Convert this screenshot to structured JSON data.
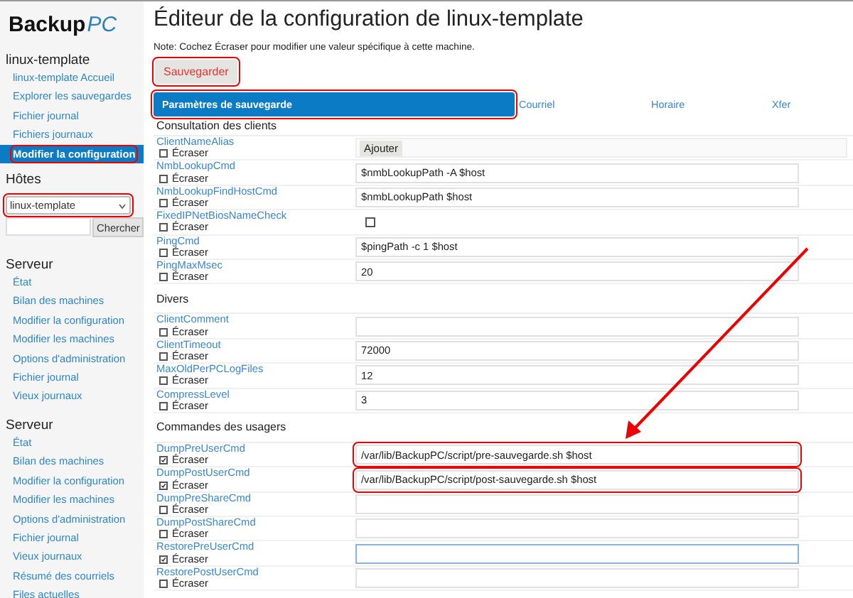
{
  "logo": {
    "text": "Backup",
    "accent": "PC"
  },
  "sidebar": {
    "host_section": {
      "title": "linux-template",
      "items": [
        {
          "label": "linux-template Accueil",
          "selected": false,
          "highlighted": false
        },
        {
          "label": "Explorer les sauvegardes",
          "selected": false,
          "highlighted": false
        },
        {
          "label": "Fichier journal",
          "selected": false,
          "highlighted": false
        },
        {
          "label": "Fichiers journaux",
          "selected": false,
          "highlighted": false
        },
        {
          "label": "Modifier la configuration",
          "selected": true,
          "highlighted": true
        }
      ]
    },
    "hosts": {
      "title": "Hôtes",
      "select_value": "linux-template",
      "highlighted": true,
      "search_button": "Chercher"
    },
    "server_sections": [
      {
        "title": "Serveur",
        "items": [
          {
            "label": "État"
          },
          {
            "label": "Bilan des machines"
          },
          {
            "label": "Modifier la configuration"
          },
          {
            "label": "Modifier les machines"
          },
          {
            "label": "Options d'administration"
          },
          {
            "label": "Fichier journal"
          },
          {
            "label": "Vieux journaux"
          }
        ]
      },
      {
        "title": "Serveur",
        "items": [
          {
            "label": "État"
          },
          {
            "label": "Bilan des machines"
          },
          {
            "label": "Modifier la configuration"
          },
          {
            "label": "Modifier les machines"
          },
          {
            "label": "Options d'administration"
          },
          {
            "label": "Fichier journal"
          },
          {
            "label": "Vieux journaux"
          },
          {
            "label": "Résumé des courriels"
          },
          {
            "label": "Files actuelles"
          }
        ]
      }
    ]
  },
  "main": {
    "title": "Éditeur de la configuration de linux-template",
    "note": "Note: Cochez Écraser pour modifier une valeur spécifique à cette machine.",
    "save_button": {
      "label": "Sauvegarder",
      "highlighted": true
    },
    "tabs": [
      {
        "label": "Paramètres de sauvegarde",
        "selected": true,
        "highlighted": true
      },
      {
        "label": "Courriel",
        "selected": false,
        "highlighted": false
      },
      {
        "label": "Horaire",
        "selected": false,
        "highlighted": false
      },
      {
        "label": "Xfer",
        "selected": false,
        "highlighted": false
      }
    ],
    "sections": [
      {
        "title": "Consultation des clients",
        "rows": [
          {
            "name": "ClientNameAlias",
            "override_label": "Écraser",
            "override": false,
            "kind": "add",
            "button": "Ajouter"
          },
          {
            "name": "NmbLookupCmd",
            "override_label": "Écraser",
            "override": false,
            "kind": "text",
            "value": "$nmbLookupPath -A $host",
            "highlighted": false,
            "focused": false
          },
          {
            "name": "NmbLookupFindHostCmd",
            "override_label": "Écraser",
            "override": false,
            "kind": "text",
            "value": "$nmbLookupPath $host",
            "highlighted": false,
            "focused": false
          },
          {
            "name": "FixedIPNetBiosNameCheck",
            "override_label": "Écraser",
            "override": false,
            "kind": "checkbox",
            "checked": false
          },
          {
            "name": "PingCmd",
            "override_label": "Écraser",
            "override": false,
            "kind": "text",
            "value": "$pingPath -c 1 $host",
            "highlighted": false,
            "focused": false
          },
          {
            "name": "PingMaxMsec",
            "override_label": "Écraser",
            "override": false,
            "kind": "text",
            "value": "20",
            "highlighted": false,
            "focused": false
          }
        ]
      },
      {
        "title": "Divers",
        "rows": [
          {
            "name": "ClientComment",
            "override_label": "Écraser",
            "override": false,
            "kind": "text",
            "highlighted": false,
            "focused": false
          },
          {
            "name": "ClientTimeout",
            "override_label": "Écraser",
            "override": false,
            "kind": "text",
            "value": "72000",
            "highlighted": false,
            "focused": false
          },
          {
            "name": "MaxOldPerPCLogFiles",
            "override_label": "Écraser",
            "override": false,
            "kind": "text",
            "value": "12",
            "highlighted": false,
            "focused": false
          },
          {
            "name": "CompressLevel",
            "override_label": "Écraser",
            "override": false,
            "kind": "text",
            "value": "3",
            "highlighted": false,
            "focused": false
          }
        ]
      },
      {
        "title": "Commandes des usagers",
        "rows": [
          {
            "name": "DumpPreUserCmd",
            "override_label": "Écraser",
            "override": true,
            "kind": "text",
            "value": "/var/lib/BackupPC/script/pre-sauvegarde.sh $host",
            "highlighted": true,
            "focused": false
          },
          {
            "name": "DumpPostUserCmd",
            "override_label": "Écraser",
            "override": true,
            "kind": "text",
            "value": "/var/lib/BackupPC/script/post-sauvegarde.sh $host",
            "highlighted": true,
            "focused": false
          },
          {
            "name": "DumpPreShareCmd",
            "override_label": "Écraser",
            "override": false,
            "kind": "text",
            "highlighted": false,
            "focused": false
          },
          {
            "name": "DumpPostShareCmd",
            "override_label": "Écraser",
            "override": false,
            "kind": "text",
            "highlighted": false,
            "focused": false
          },
          {
            "name": "RestorePreUserCmd",
            "override_label": "Écraser",
            "override": true,
            "kind": "text",
            "highlighted": false,
            "focused": true
          },
          {
            "name": "RestorePostUserCmd",
            "override_label": "Écraser",
            "override": false,
            "kind": "text",
            "highlighted": false,
            "focused": false
          }
        ]
      }
    ]
  },
  "annotation_arrow": true
}
